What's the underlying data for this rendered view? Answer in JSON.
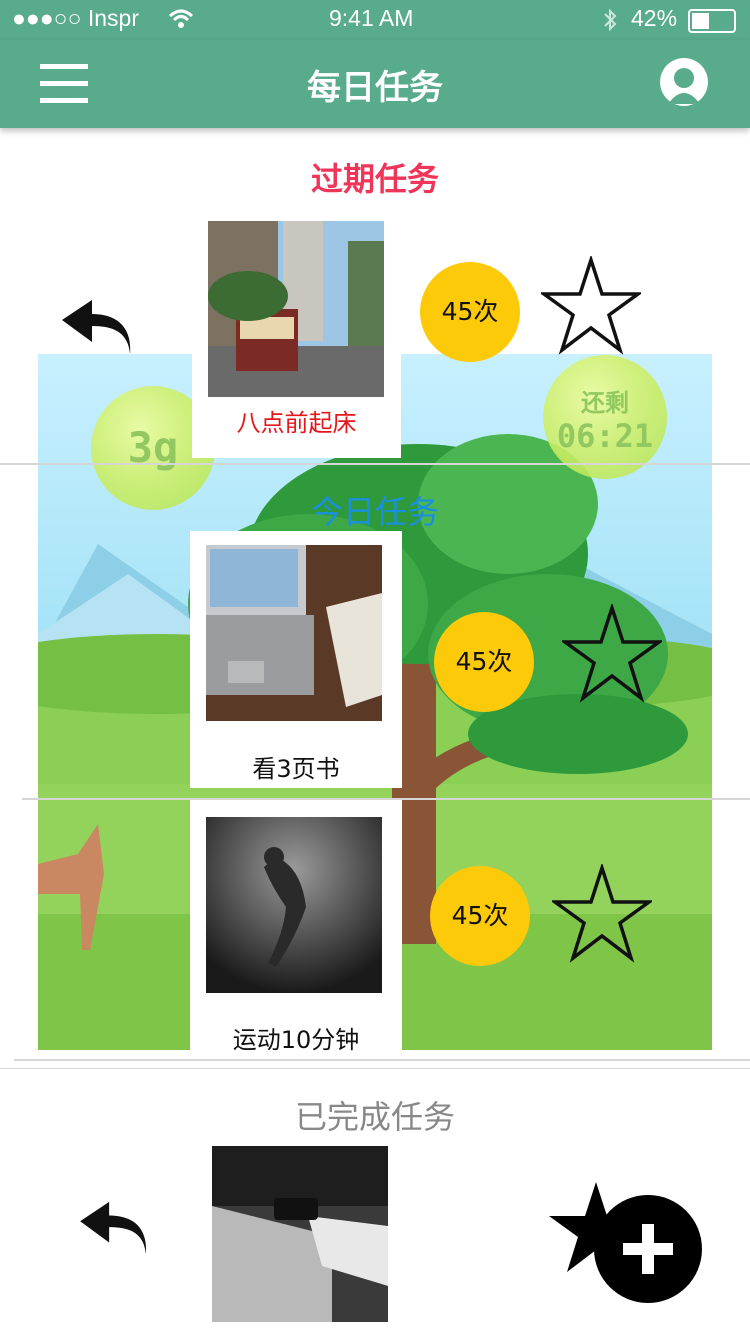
{
  "status": {
    "carrier": "●●●○○ Inspr",
    "time": "9:41 AM",
    "battery": "42%"
  },
  "header": {
    "title": "每日任务"
  },
  "overdue": {
    "title": "过期任务",
    "task": {
      "name": "八点前起床",
      "count": "45次"
    }
  },
  "scene": {
    "weight": "3g",
    "remaining_label": "还剩",
    "remaining_time": "06:21"
  },
  "today": {
    "title": "今日任务",
    "tasks": [
      {
        "name": "看3页书",
        "count": "45次"
      },
      {
        "name": "运动10分钟",
        "count": "45次"
      }
    ]
  },
  "completed": {
    "title": "已完成任务"
  },
  "colors": {
    "brand": "#58ab8b",
    "overdue": "#f0355b",
    "today": "#1a8fe0",
    "count_badge": "#fdca0a",
    "completed": "#888888"
  },
  "icons": [
    "menu-icon",
    "user-icon",
    "back-arrow-icon",
    "star-icon",
    "star-add-icon"
  ]
}
